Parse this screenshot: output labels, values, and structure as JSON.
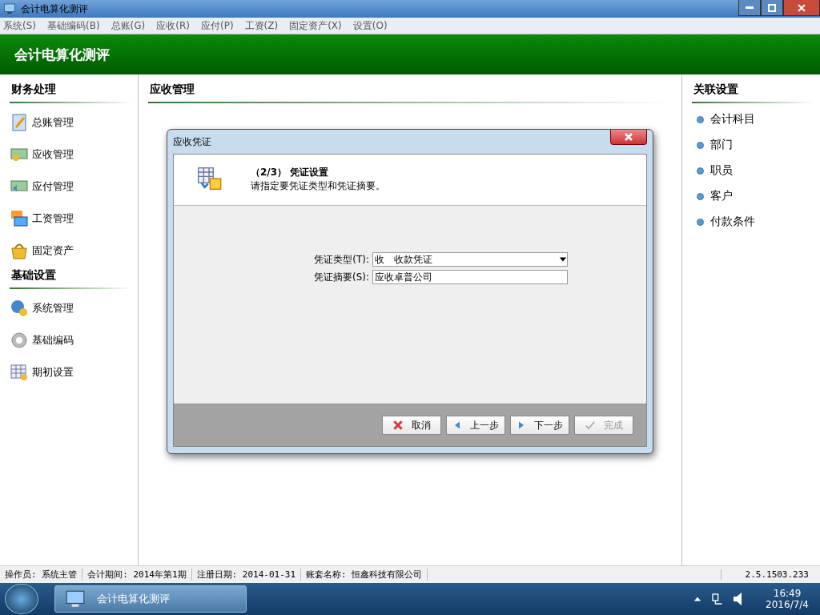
{
  "window": {
    "title": "会计电算化测评"
  },
  "menu": [
    "系统(S)",
    "基础编码(B)",
    "总账(G)",
    "应收(R)",
    "应付(P)",
    "工资(Z)",
    "固定资产(X)",
    "设置(O)"
  ],
  "banner": {
    "title": "会计电算化测评"
  },
  "left_panel": {
    "sections": [
      {
        "title": "财务处理",
        "items": [
          "总账管理",
          "应收管理",
          "应付管理",
          "工资管理",
          "固定资产"
        ]
      },
      {
        "title": "基础设置",
        "items": [
          "系统管理",
          "基础编码",
          "期初设置"
        ]
      }
    ]
  },
  "center": {
    "title": "应收管理"
  },
  "right_panel": {
    "title": "关联设置",
    "items": [
      "会计科目",
      "部门",
      "职员",
      "客户",
      "付款条件"
    ]
  },
  "dialog": {
    "title": "应收凭证",
    "step": "（2/3） 凭证设置",
    "instruction": "请指定要凭证类型和凭证摘要。",
    "fields": [
      {
        "kind": "select",
        "label": "凭证类型(T):",
        "value": "收　收款凭证"
      },
      {
        "kind": "text",
        "label": "凭证摘要(S):",
        "value": "应收卓普公司"
      }
    ],
    "buttons": [
      {
        "kind": "cancel",
        "label": "取消",
        "disabled": false
      },
      {
        "kind": "back",
        "label": "上一步",
        "disabled": false
      },
      {
        "kind": "next",
        "label": "下一步",
        "disabled": false
      },
      {
        "kind": "finish",
        "label": "完成",
        "disabled": true
      }
    ]
  },
  "status_bar": [
    "操作员: 系统主管",
    "会计期间: 2014年第1期",
    "注册日期: 2014-01-31",
    "账套名称: 恒鑫科技有限公司",
    "2.5.1503.233"
  ],
  "taskbar": {
    "task": "会计电算化测评",
    "time": "16:49",
    "date": "2016/7/4"
  }
}
